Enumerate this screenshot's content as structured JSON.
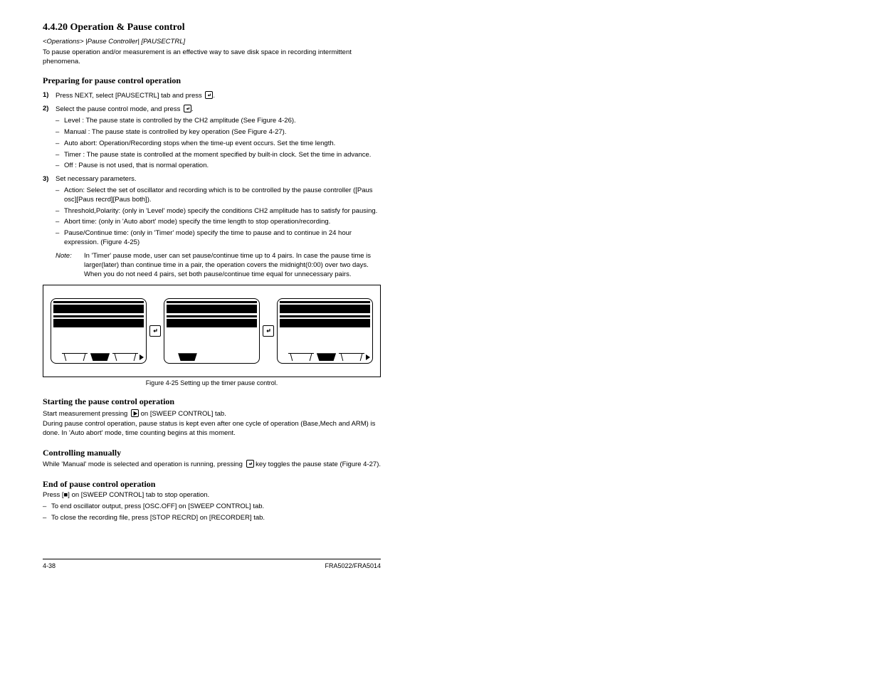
{
  "section": {
    "number": "4.4.20",
    "title": "Operation & Pause control"
  },
  "intro": "<Operations> |Pause Controller| [PAUSECTRL]",
  "intro_desc": "To pause operation and/or measurement is an effective way to save disk space in recording intermittent phenomena.",
  "sub": {
    "title": "Preparing for pause control operation",
    "steps": [
      {
        "num": "1)",
        "text_before": "Press NEXT, select [PAUSECTRL] tab and press ",
        "text_after": "."
      },
      {
        "num": "2)",
        "text_before": "Select the pause control mode,  and press ",
        "text_after": "."
      }
    ],
    "modes": [
      {
        "name": "Level :",
        "desc": "The pause state is controlled by the CH2 amplitude (See Figure 4-26)."
      },
      {
        "name": "Manual :",
        "desc": "The pause state is controlled by key operation (See Figure 4-27)."
      },
      {
        "name": "Auto abort:",
        "desc": "Operation/Recording stops when the time-up event occurs. Set the time length."
      },
      {
        "name": "Timer :",
        "desc": "The pause state is controlled at the moment specified by built-in clock. Set the time in advance."
      },
      {
        "name": "Off :",
        "desc": "Pause is not used, that is normal operation."
      }
    ],
    "step3": {
      "num": "3)",
      "text": "Set necessary parameters."
    },
    "params": [
      "Action: Select the set of oscillator and recording which is to be controlled by the pause controller ([Paus osc][Paus recrd][Paus both]).",
      "Threshold,Polarity: (only in 'Level' mode) specify the conditions CH2 amplitude has to satisfy for pausing.",
      "Abort time: (only in 'Auto abort' mode) specify the time length to stop operation/recording.",
      "Pause/Continue time: (only in 'Timer' mode) specify the time to pause and to continue in 24 hour expression. (Figure 4-25)"
    ]
  },
  "note": {
    "label": "Note:",
    "text": "In 'Timer' pause mode, user can set pause/continue time up to 4 pairs. In case the pause time is larger(later) than continue time in a pair, the operation covers the midnight(0:00) over two days. When you do not need 4 pairs, set both pause/continue time equal for unnecessary pairs."
  },
  "figure": {
    "caption": "Figure 4-25 Setting up the timer pause control."
  },
  "start": {
    "title": "Starting the pause control operation",
    "text_before": "Start measurement pressing ",
    "text_after": " on [SWEEP CONTROL] tab.",
    "desc": "During pause control operation, pause status is kept even after one cycle of operation (Base,Mech and ARM) is done. In 'Auto abort' mode, time counting begins at this moment."
  },
  "manual_ctrl": {
    "title": "Controlling manually",
    "text_before": "While 'Manual' mode is selected and operation is running, pressing ",
    "text_after": " key toggles the pause state (Figure 4-27)."
  },
  "end": {
    "title": "End of pause control operation",
    "text": "Press [■] on [SWEEP CONTROL] tab to stop operation.",
    "opts": [
      "To end oscillator output, press [OSC.OFF] on [SWEEP CONTROL] tab.",
      "To close the recording file, press [STOP RECRD] on [RECORDER] tab."
    ]
  },
  "footer": {
    "left": "4-38",
    "right": "FRA5022/FRA5014"
  }
}
